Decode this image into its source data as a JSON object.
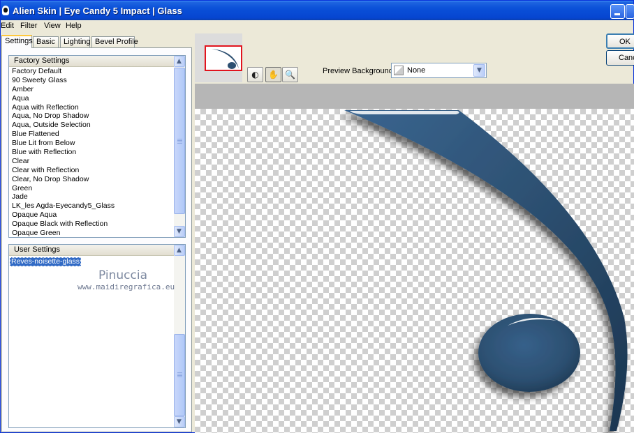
{
  "window": {
    "title": "Alien Skin | Eye Candy 5 Impact | Glass"
  },
  "menu": {
    "items": [
      "Edit",
      "Filter",
      "View",
      "Help"
    ]
  },
  "tabs": [
    "Settings",
    "Basic",
    "Lighting",
    "Bevel Profile"
  ],
  "factory_settings": {
    "header": "Factory Settings",
    "items": [
      "Factory Default",
      "90 Sweety Glass",
      "Amber",
      "Aqua",
      "Aqua with Reflection",
      "Aqua, No Drop Shadow",
      "Aqua, Outside Selection",
      "Blue Flattened",
      "Blue Lit from Below",
      "Blue with Reflection",
      "Clear",
      "Clear with Reflection",
      "Clear, No Drop Shadow",
      "Green",
      "Jade",
      "LK_les Agda-Eyecandy5_Glass",
      "Opaque Aqua",
      "Opaque Black with Reflection",
      "Opaque Green"
    ]
  },
  "user_settings": {
    "header": "User Settings",
    "selected": "Reves-noisette-glass"
  },
  "watermark": {
    "name": "Pinuccia",
    "url": "www.maidiregrafica.eu"
  },
  "preview": {
    "background_label": "Preview Background:",
    "background_value": "None"
  },
  "buttons": {
    "ok": "OK",
    "cancel": "Cancel"
  },
  "colors": {
    "shape_fill": "#2c4f70",
    "titlebar": "#0a50d8",
    "selection": "#316ac5"
  },
  "icons": [
    "compare-icon",
    "hand-icon",
    "zoom-icon",
    "chevron-down-icon"
  ]
}
